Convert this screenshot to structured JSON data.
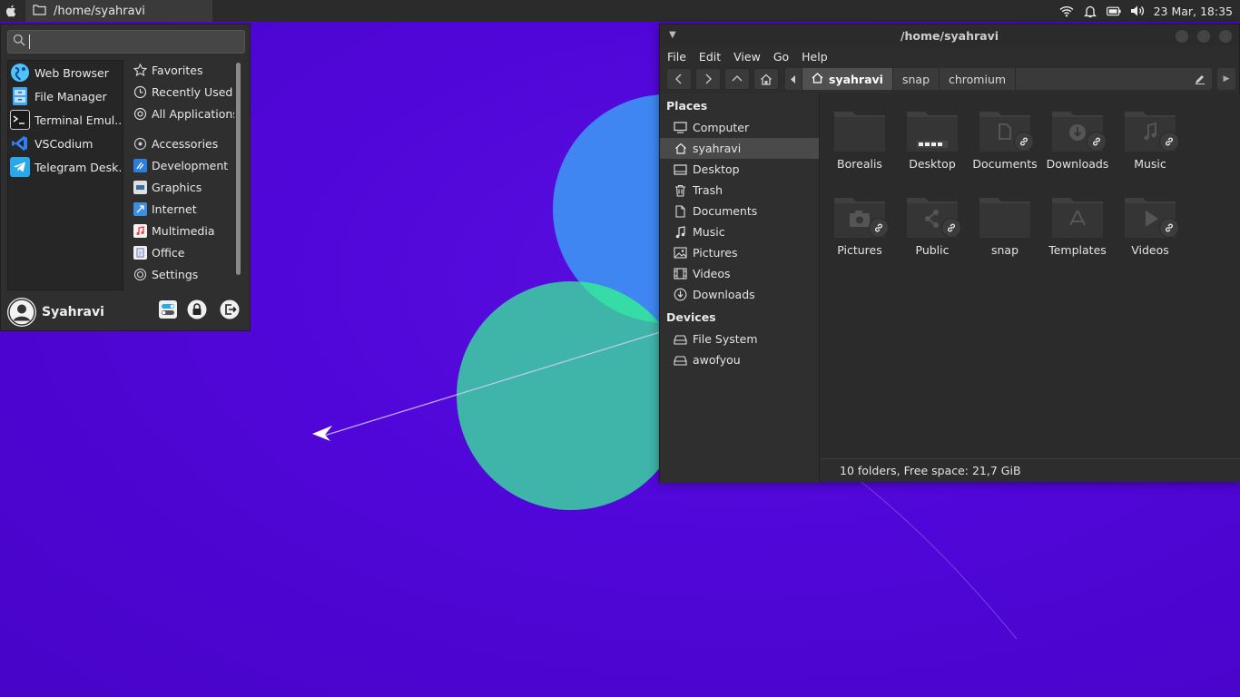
{
  "top_panel": {
    "task_title": "/home/syahravi",
    "clock": "23 Mar, 18:35",
    "tray_icons": [
      "wifi-icon",
      "bell-icon",
      "battery-icon",
      "volume-icon"
    ]
  },
  "app_menu": {
    "search": {
      "value": "",
      "placeholder": ""
    },
    "favorites": [
      {
        "label": "Web Browser",
        "icon": "web-browser-icon"
      },
      {
        "label": "File Manager",
        "icon": "file-manager-icon"
      },
      {
        "label": "Terminal Emul...",
        "icon": "terminal-icon"
      },
      {
        "label": "VSCodium",
        "icon": "vscodium-icon"
      },
      {
        "label": "Telegram Desk...",
        "icon": "telegram-icon"
      }
    ],
    "categories_top": [
      "Favorites",
      "Recently Used",
      "All Applications"
    ],
    "categories": [
      "Accessories",
      "Development",
      "Graphics",
      "Internet",
      "Multimedia",
      "Office",
      "Settings"
    ],
    "user_name": "Syahravi"
  },
  "file_manager": {
    "title": "/home/syahravi",
    "menus": [
      "File",
      "Edit",
      "View",
      "Go",
      "Help"
    ],
    "path": [
      "syahravi",
      "snap",
      "chromium"
    ],
    "places_heading": "Places",
    "places": [
      "Computer",
      "syahravi",
      "Desktop",
      "Trash",
      "Documents",
      "Music",
      "Pictures",
      "Videos",
      "Downloads"
    ],
    "devices_heading": "Devices",
    "devices": [
      "File System",
      "awofyou"
    ],
    "folders": [
      {
        "name": "Borealis",
        "link": false
      },
      {
        "name": "Desktop",
        "link": false
      },
      {
        "name": "Documents",
        "link": true
      },
      {
        "name": "Downloads",
        "link": true
      },
      {
        "name": "Music",
        "link": true
      },
      {
        "name": "Pictures",
        "link": true
      },
      {
        "name": "Public",
        "link": true
      },
      {
        "name": "snap",
        "link": false
      },
      {
        "name": "Templates",
        "link": false
      },
      {
        "name": "Videos",
        "link": true
      }
    ],
    "status": "10 folders, Free space: 21,7 GiB"
  },
  "colors": {
    "desktop": "#5006d8",
    "panel": "#2b2b2b",
    "circle_blue": "#3f86f2",
    "circle_teal": "#3fb4a8",
    "overlap": "#35dca6"
  }
}
